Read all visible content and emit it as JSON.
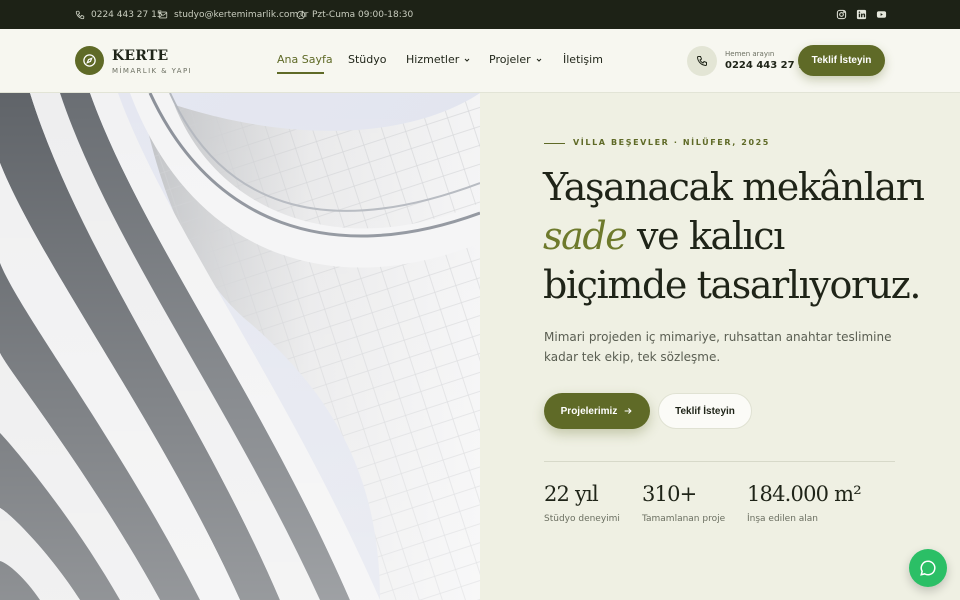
{
  "topbar": {
    "phone": "0224 443 27 15",
    "email": "studyo@kertemimarlik.com.tr",
    "hours": "Pzt-Cuma 09:00-18:30",
    "social_icons": [
      "instagram-icon",
      "linkedin-icon",
      "youtube-icon"
    ]
  },
  "header": {
    "logo_name": "KERTE",
    "logo_sub": "MİMARLIK & YAPI",
    "nav": [
      {
        "label": "Ana Sayfa",
        "active": true
      },
      {
        "label": "Stüdyo"
      },
      {
        "label": "Hizmetler",
        "dropdown": true
      },
      {
        "label": "Projeler",
        "dropdown": true
      },
      {
        "label": "İletişim"
      }
    ],
    "call_label": "Hemen arayın",
    "call_number": "0224 443 27 15",
    "cta": "Teklif İsteyin"
  },
  "hero": {
    "eyebrow": "VİLLA BEŞEVLER · NİLÜFER, 2025",
    "headline_line1": "Yaşanacak mekânları",
    "headline_accent": "sade",
    "headline_line2_rest": " ve kalıcı",
    "headline_line3": "biçimde tasarlıyoruz.",
    "lead": "Mimari projeden iç mimariye, ruhsattan anahtar teslimine kadar tek ekip, tek sözleşme.",
    "btn_primary": "Projelerimiz",
    "btn_secondary": "Teklif İsteyin",
    "stats": [
      {
        "value": "22 yıl",
        "label": "Stüdyo deneyimi"
      },
      {
        "value": "310+",
        "label": "Tamamlanan proje"
      },
      {
        "value": "184.000 m²",
        "label": "İnşa edilen alan"
      }
    ]
  },
  "colors": {
    "accent": "#5f6a27",
    "topbar": "#1d2216",
    "background": "#eff0e3",
    "chat": "#2bbf66"
  }
}
